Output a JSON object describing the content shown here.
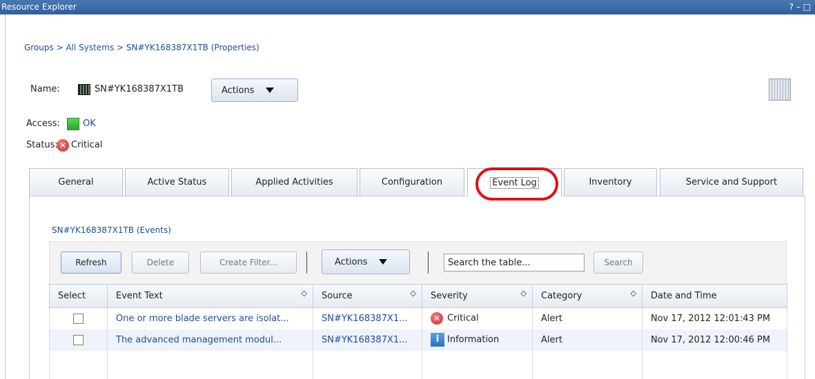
{
  "window": {
    "title": "Resource Explorer",
    "controls": "? – □"
  },
  "breadcrumb": "Groups > All Systems > SN#YK168387X1TB (Properties)",
  "properties": {
    "name_label": "Name:",
    "name_value": "SN#YK168387X1TB",
    "actions_label": "Actions",
    "access_label": "Access:",
    "access_value": "OK",
    "status_label": "Status:",
    "status_value": "Critical"
  },
  "tabs": [
    {
      "label": "General"
    },
    {
      "label": "Active Status"
    },
    {
      "label": "Applied Activities"
    },
    {
      "label": "Configuration"
    },
    {
      "label": "Event Log",
      "active": true
    },
    {
      "label": "Inventory"
    },
    {
      "label": "Service and Support"
    }
  ],
  "events": {
    "title": "SN#YK168387X1TB (Events)",
    "toolbar": {
      "refresh": "Refresh",
      "delete": "Delete",
      "create_filter": "Create Filter...",
      "actions": "Actions",
      "search_value": "Search the table...",
      "search": "Search"
    },
    "columns": [
      "Select",
      "Event Text",
      "Source",
      "Severity",
      "Category",
      "Date and Time"
    ],
    "rows": [
      {
        "event_text": "One or more blade servers are isolat...",
        "source": "SN#YK168387X1...",
        "severity": "Critical",
        "category": "Alert",
        "date_time": "Nov 17, 2012 12:01:43 PM"
      },
      {
        "event_text": "The advanced management modul...",
        "source": "SN#YK168387X1...",
        "severity": "Information",
        "category": "Alert",
        "date_time": "Nov 17, 2012 12:00:46 PM"
      }
    ]
  },
  "colors": {
    "titlebar": "#2f5f9c",
    "link": "#1d4d99",
    "highlight_circle": "#e01111",
    "critical": "#cf2626",
    "ok": "#2ea52e"
  }
}
